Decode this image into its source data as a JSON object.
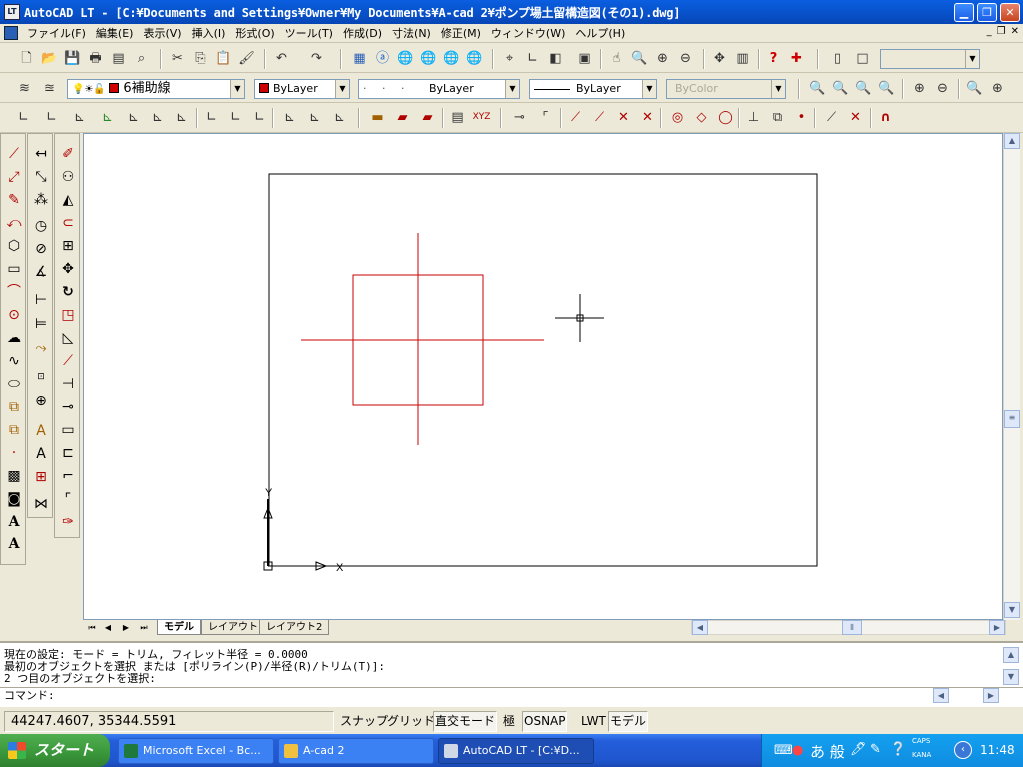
{
  "window": {
    "title": "AutoCAD LT - [C:¥Documents and Settings¥Owner¥My Documents¥A-cad 2¥ポンプ場土留構造図(その1).dwg]",
    "minimize_icon": "minimize-icon",
    "maximize_icon": "maximize-icon",
    "close_icon": "close-icon"
  },
  "menu": [
    "ファイル(F)",
    "編集(E)",
    "表示(V)",
    "挿入(I)",
    "形式(O)",
    "ツール(T)",
    "作成(D)",
    "寸法(N)",
    "修正(M)",
    "ウィンドウ(W)",
    "ヘルプ(H)"
  ],
  "layer_toolbar": {
    "layer_name": "6補助線",
    "color": "ByLayer",
    "linetype": "ByLayer",
    "lineweight": "ByLayer",
    "plot_style": "ByColor",
    "layer_color": "#cc0000"
  },
  "ucs_labels": {
    "y": "Y",
    "x": "X"
  },
  "layout_tabs": [
    "モデル",
    "レイアウト1",
    "レイアウト2"
  ],
  "command": {
    "lines": [
      "現在の設定: モード = トリム, フィレット半径 = 0.0000",
      "最初のオブジェクトを選択 または [ポリライン(P)/半径(R)/トリム(T)]:",
      "2 つ目のオブジェクトを選択:"
    ],
    "prompt": "コマンド:"
  },
  "status": {
    "coordinates": "44247.4607, 35344.5591",
    "toggles": [
      {
        "label": "スナップ",
        "on": false
      },
      {
        "label": "グリッド",
        "on": false
      },
      {
        "label": "直交モード",
        "on": true
      },
      {
        "label": "極",
        "on": false
      },
      {
        "label": "OSNAP",
        "on": true
      },
      {
        "label": "LWT",
        "on": false
      },
      {
        "label": "モデル",
        "on": true
      }
    ]
  },
  "taskbar": {
    "start": "スタート",
    "tasks": [
      {
        "label": "Microsoft Excel - Bc...",
        "icon": "excel-icon",
        "color": "#1d7a3c"
      },
      {
        "label": "A-cad 2",
        "icon": "folder-icon",
        "color": "#f0c040"
      },
      {
        "label": "AutoCAD LT - [C:¥D...",
        "icon": "autocad-icon",
        "color": "#d0d8e8"
      }
    ],
    "ime": "あ 般",
    "caps": "CAPS",
    "kana": "KANA",
    "clock": "11:48"
  },
  "colors": {
    "drawing_red": "#cc0000",
    "frame": "#000000"
  }
}
